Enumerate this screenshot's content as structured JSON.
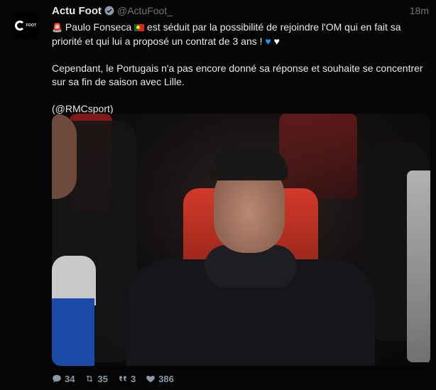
{
  "tweet": {
    "author_name": "Actu Foot",
    "author_handle": "@ActuFoot_",
    "time": "18m",
    "avatar_text": "FOOT",
    "para1_pre": "Paulo Fonseca",
    "para1_post": "est séduit par la possibilité de rejoindre l'OM qui en fait sa priorité et qui lui a proposé un contrat de 3 ans !",
    "para2": "Cependant, le Portugais n'a pas encore donné sa réponse et souhaite se concentrer sur sa fin de saison avec Lille.",
    "source": "(@RMCsport)"
  },
  "actions": {
    "replies": "34",
    "retweets": "35",
    "quotes": "3",
    "likes": "386"
  },
  "icons": {
    "siren": "siren-emoji",
    "flag": "portugal-flag-emoji",
    "heart_blue": "blue-heart-emoji",
    "heart_white": "white-heart-emoji",
    "verified": "verified-badge-icon",
    "reply": "reply-icon",
    "retweet": "retweet-icon",
    "quote": "quote-icon",
    "like": "heart-icon"
  },
  "colors": {
    "background": "#050505",
    "text": "#e7e9ea",
    "muted": "#71767b",
    "accent": "#1d9bf0"
  }
}
